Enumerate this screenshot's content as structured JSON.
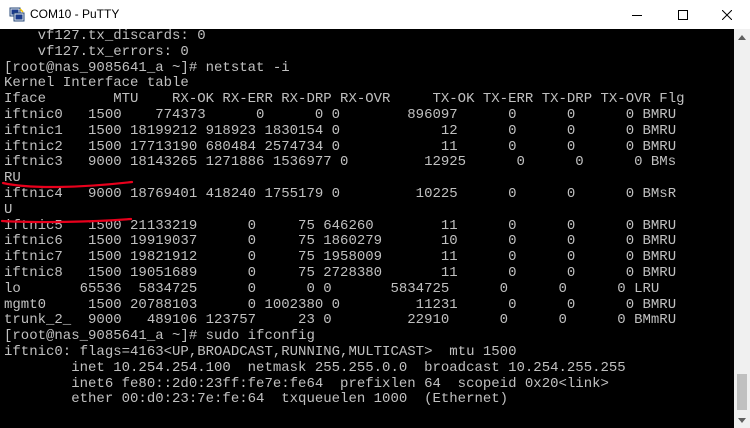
{
  "window": {
    "title": "COM10 - PuTTY"
  },
  "icons": {
    "app": "putty-icon",
    "minimize": "minimize-icon",
    "maximize": "maximize-icon",
    "close": "close-icon"
  },
  "colors": {
    "terminal_bg": "#000000",
    "terminal_fg": "#c0c0c0",
    "annotation": "#e8001c"
  },
  "terminal": {
    "lines": [
      "    vf127.tx_discards: 0",
      "    vf127.tx_errors: 0",
      "[root@nas_9085641_a ~]# netstat -i",
      "Kernel Interface table",
      "Iface        MTU    RX-OK RX-ERR RX-DRP RX-OVR     TX-OK TX-ERR TX-DRP TX-OVR Flg",
      "iftnic0   1500    774373      0      0 0        896097      0      0      0 BMRU",
      "iftnic1   1500 18199212 918923 1830154 0            12      0      0      0 BMRU",
      "iftnic2   1500 17713190 680484 2574734 0            11      0      0      0 BMRU",
      "iftnic3   9000 18143265 1271886 1536977 0         12925      0      0      0 BMs",
      "RU",
      "iftnic4   9000 18769401 418240 1755179 0         10225      0      0      0 BMsR",
      "U",
      "iftnic5   1500 21133219      0     75 646260        11      0      0      0 BMRU",
      "iftnic6   1500 19919037      0     75 1860279       10      0      0      0 BMRU",
      "iftnic7   1500 19821912      0     75 1958009       11      0      0      0 BMRU",
      "iftnic8   1500 19051689      0     75 2728380       11      0      0      0 BMRU",
      "lo       65536  5834725      0      0 0       5834725      0      0      0 LRU",
      "mgmt0     1500 20788103      0 1002380 0         11231      0      0      0 BMRU",
      "trunk_2_  9000   489106 123757     23 0         22910      0      0      0 BMmRU",
      "[root@nas_9085641_a ~]# sudo ifconfig",
      "iftnic0: flags=4163<UP,BROADCAST,RUNNING,MULTICAST>  mtu 1500",
      "        inet 10.254.254.100  netmask 255.255.0.0  broadcast 10.254.255.255",
      "        inet6 fe80::2d0:23ff:fe7e:fe64  prefixlen 64  scopeid 0x20<link>",
      "        ether 00:d0:23:7e:fe:64  txqueuelen 1000  (Ethernet)"
    ]
  }
}
